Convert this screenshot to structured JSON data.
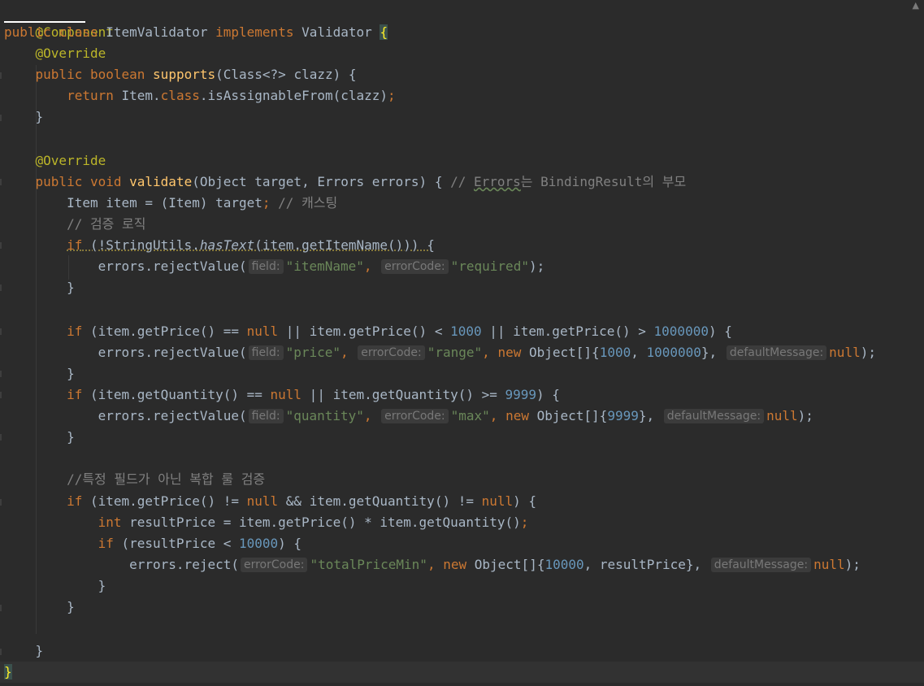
{
  "editor": {
    "warning_icon": "warning-triangle-icon",
    "annotation_component": "@Component",
    "class_decl": {
      "public": "public",
      "class": "class",
      "name": "ItemValidator",
      "implements": "implements",
      "iface": "Validator",
      "open": "{"
    },
    "override": "@Override",
    "supports": {
      "public": "public",
      "boolean": "boolean",
      "name": "supports",
      "params": "(Class<?> clazz) {",
      "return": "return",
      "item": "Item.",
      "class": "class",
      "call": ".isAssignableFrom(clazz)",
      "semi": ";",
      "close": "}"
    },
    "validate": {
      "public": "public",
      "void": "void",
      "name": "validate",
      "params": "(Object target, Errors errors) { ",
      "comment_prefix": "// ",
      "comment_errors": "Errors",
      "comment_mid": "는 BindingResult의 부모",
      "cast_line_a": "Item item = (Item) target",
      "cast_semi": ";",
      "cast_comment": " // 캐스팅",
      "logic_comment": "// 검증 로직"
    },
    "block1": {
      "if": "if",
      "cond_a": " (!StringUtils.",
      "cond_method": "hasText",
      "cond_b": "(item.getItemName())) {",
      "call": "errors.rejectValue(",
      "hint_field": "field:",
      "field_value": "\"itemName\"",
      "comma": ",",
      "hint_code": "errorCode:",
      "code_value": "\"required\"",
      "end": ");",
      "close": "}"
    },
    "block2": {
      "if": "if",
      "cond_a": " (item.getPrice() == ",
      "null": "null",
      "cond_b": " || item.getPrice() < ",
      "num_a": "1000",
      "cond_c": " || item.getPrice() > ",
      "num_b": "1000000",
      "cond_d": ") {",
      "call": "errors.rejectValue(",
      "hint_field": "field:",
      "field_value": "\"price\"",
      "hint_code": "errorCode:",
      "code_value": "\"range\"",
      "new": "new",
      "obj": " Object[]{",
      "arg_a": "1000",
      "arg_sep": ", ",
      "arg_b": "1000000",
      "obj_close": "},",
      "hint_msg": "defaultMessage:",
      "msg_value": "null",
      "end": ");",
      "close": "}"
    },
    "block3": {
      "if": "if",
      "cond_a": " (item.getQuantity() == ",
      "null": "null",
      "cond_b": " || item.getQuantity() >= ",
      "num": "9999",
      "cond_c": ") {",
      "call": "errors.rejectValue(",
      "hint_field": "field:",
      "field_value": "\"quantity\"",
      "hint_code": "errorCode:",
      "code_value": "\"max\"",
      "new": "new",
      "obj": " Object[]{",
      "arg": "9999",
      "obj_close": "},",
      "hint_msg": "defaultMessage:",
      "msg_value": "null",
      "end": ");",
      "close": "}"
    },
    "block4": {
      "comment": "//특정 필드가 아닌 복합 룰 검증",
      "if": "if",
      "cond_a": " (item.getPrice() != ",
      "null_a": "null",
      "cond_b": " && item.getQuantity() != ",
      "null_b": "null",
      "cond_c": ") {",
      "int": "int",
      "assign": " resultPrice = item.getPrice() * item.getQuantity()",
      "semi": ";",
      "inner_if": "if",
      "inner_cond_a": " (resultPrice < ",
      "inner_num": "10000",
      "inner_cond_b": ") {",
      "call": "errors.reject(",
      "hint_code": "errorCode:",
      "code_value": "\"totalPriceMin\"",
      "new": "new",
      "obj": " Object[]{",
      "arg": "10000",
      "arg_rest": ", resultPrice},",
      "hint_msg": "defaultMessage:",
      "msg_value": "null",
      "end": ");",
      "inner_close": "}",
      "close": "}"
    },
    "method_close": "}",
    "class_close": "}"
  }
}
